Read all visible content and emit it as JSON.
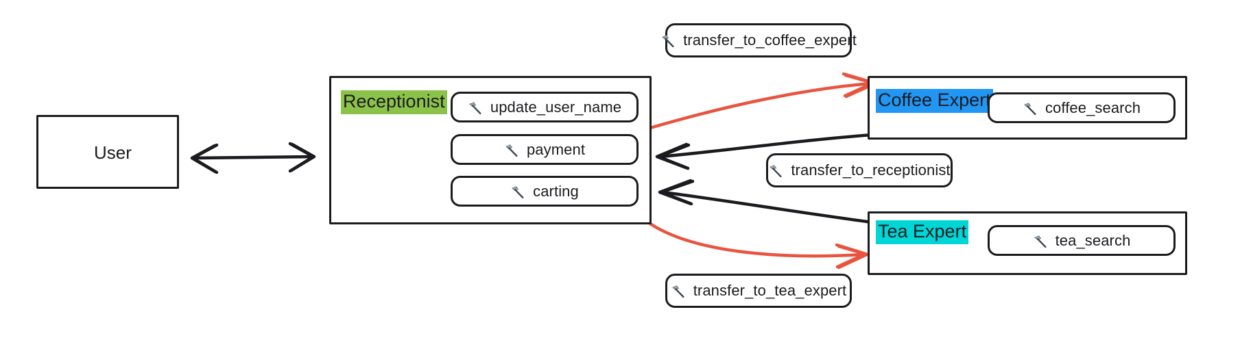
{
  "diagram": {
    "title": "multi-agent receptionist handoff diagram",
    "style": "hand-drawn",
    "colors": {
      "stroke": "#1b1b1f",
      "transfer_arrow": "#e8543f",
      "return_arrow": "#1b1b1f",
      "receptionist_highlight": "#8bc34a",
      "coffee_highlight": "#2196f3",
      "tea_highlight": "#00d6d6",
      "background": "#ffffff"
    }
  },
  "nodes": {
    "user": {
      "label": "User"
    },
    "receptionist": {
      "label": "Receptionist",
      "tools": [
        {
          "name": "update_user_name",
          "icon": "hammer-icon"
        },
        {
          "name": "payment",
          "icon": "hammer-icon"
        },
        {
          "name": "carting",
          "icon": "hammer-icon"
        }
      ]
    },
    "coffee_expert": {
      "label": "Coffee Expert",
      "tools": [
        {
          "name": "coffee_search",
          "icon": "hammer-icon"
        }
      ]
    },
    "tea_expert": {
      "label": "Tea Expert",
      "tools": [
        {
          "name": "tea_search",
          "icon": "hammer-icon"
        }
      ]
    }
  },
  "edge_labels": [
    {
      "id": "transfer-to-coffee-expert",
      "name": "transfer_to_coffee_expert",
      "icon": "hammer-icon"
    },
    {
      "id": "transfer-to-receptionist",
      "name": "transfer_to_receptionist",
      "icon": "hammer-icon"
    },
    {
      "id": "transfer-to-tea-expert",
      "name": "transfer_to_tea_expert",
      "icon": "hammer-icon"
    }
  ]
}
